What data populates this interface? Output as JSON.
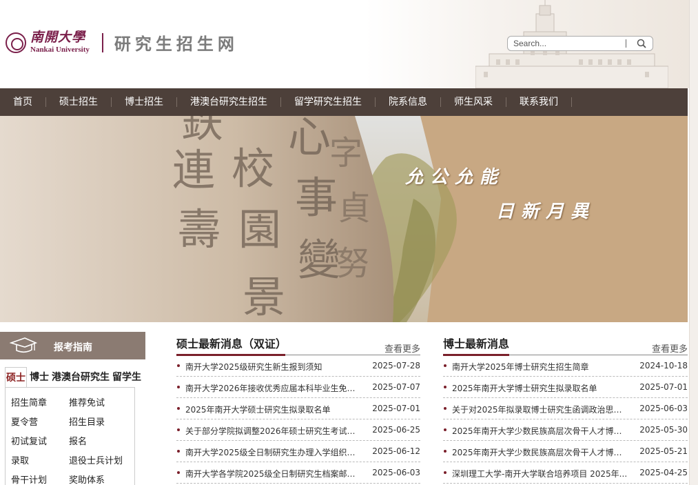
{
  "header": {
    "logo_cn": "南開大學",
    "logo_en": "Nankai University",
    "site_title": "研究生招生网",
    "search_placeholder": "Search..."
  },
  "nav": {
    "items": [
      "首页",
      "硕士招生",
      "博士招生",
      "港澳台研究生招生",
      "留学研究生招生",
      "院系信息",
      "师生风采",
      "联系我们"
    ]
  },
  "banner": {
    "motto_1": "允公允能",
    "motto_2": "日新月異"
  },
  "guide": {
    "title": "报考指南",
    "tabs": [
      "硕士",
      "博士",
      "港澳台研究生",
      "留学生"
    ],
    "links": [
      [
        "招生简章",
        "推荐免试"
      ],
      [
        "夏令营",
        "招生目录"
      ],
      [
        "初试复试",
        "报名"
      ],
      [
        "录取",
        "退役士兵计划"
      ],
      [
        "骨干计划",
        "奖助体系"
      ]
    ]
  },
  "master_news": {
    "title": "硕士最新消息（双证）",
    "more": "查看更多",
    "items": [
      {
        "title": "南开大学2025级研究生新生报到须知",
        "date": "2025-07-28"
      },
      {
        "title": "南开大学2026年接收优秀应届本科毕业生免试...",
        "date": "2025-07-07"
      },
      {
        "title": "2025年南开大学硕士研究生拟录取名单",
        "date": "2025-07-01"
      },
      {
        "title": "关于部分学院拟调整2026年硕士研究生考试招...",
        "date": "2025-06-25"
      },
      {
        "title": "南开大学2025级全日制研究生办理入学组织关...",
        "date": "2025-06-12"
      },
      {
        "title": "南开大学各学院2025级全日制研究生档案邮寄...",
        "date": "2025-06-03"
      }
    ]
  },
  "phd_news": {
    "title": "博士最新消息",
    "more": "查看更多",
    "items": [
      {
        "title": "南开大学2025年博士研究生招生简章",
        "date": "2024-10-18"
      },
      {
        "title": "2025年南开大学博士研究生拟录取名单",
        "date": "2025-07-01"
      },
      {
        "title": "关于对2025年拟录取博士研究生函调政治思想...",
        "date": "2025-06-03"
      },
      {
        "title": "2025年南开大学少数民族高层次骨干人才博士...",
        "date": "2025-05-30"
      },
      {
        "title": "2025年南开大学少数民族高层次骨干人才博士...",
        "date": "2025-05-21"
      },
      {
        "title": "深圳理工大学-南开大学联合培养项目 2025年...",
        "date": "2025-04-25"
      }
    ]
  },
  "colors": {
    "brand": "#7a1f4a",
    "nav_bg": "#4d403a",
    "guide_head_bg": "#8b7b72",
    "accent_line": "#7a1f2a"
  }
}
